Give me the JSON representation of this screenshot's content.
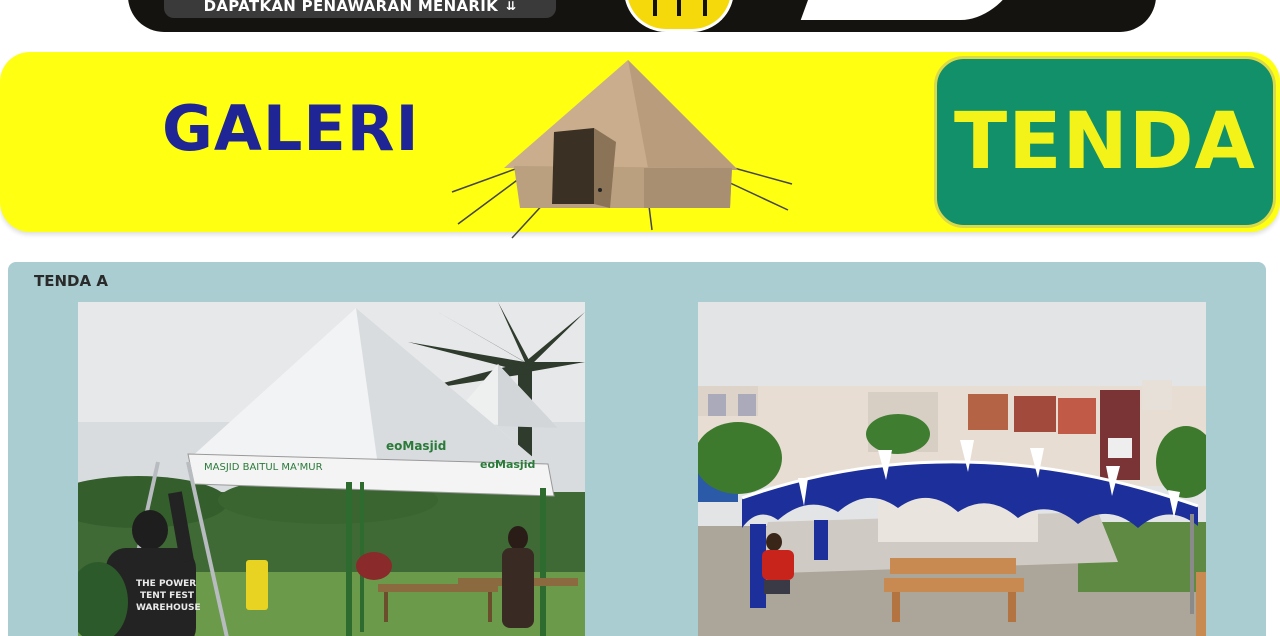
{
  "top_banner": {
    "cta_label": "DAPATKAN PENAWARAN MENARIK",
    "cta_icon": "double-chevron-down-icon"
  },
  "hero": {
    "left_title": "GALERI",
    "right_title": "TENDA",
    "colors": {
      "banner_bg": "#ffff12",
      "left_title": "#1f2594",
      "right_box": "#11906a",
      "right_title": "#f3f31a"
    }
  },
  "gallery": {
    "section_title": "TENDA A",
    "card_bg": "#a9cdd1",
    "photos": [
      {
        "description_icon": "pyramid-tent-photo",
        "signage": [
          "MASJID BAITUL MA'MUR",
          "eoMasjid",
          "eoMasjid"
        ],
        "shirt_text": "THE POWER TENT FEST WAREHOUSE"
      },
      {
        "description_icon": "decorated-tent-photo"
      }
    ]
  }
}
